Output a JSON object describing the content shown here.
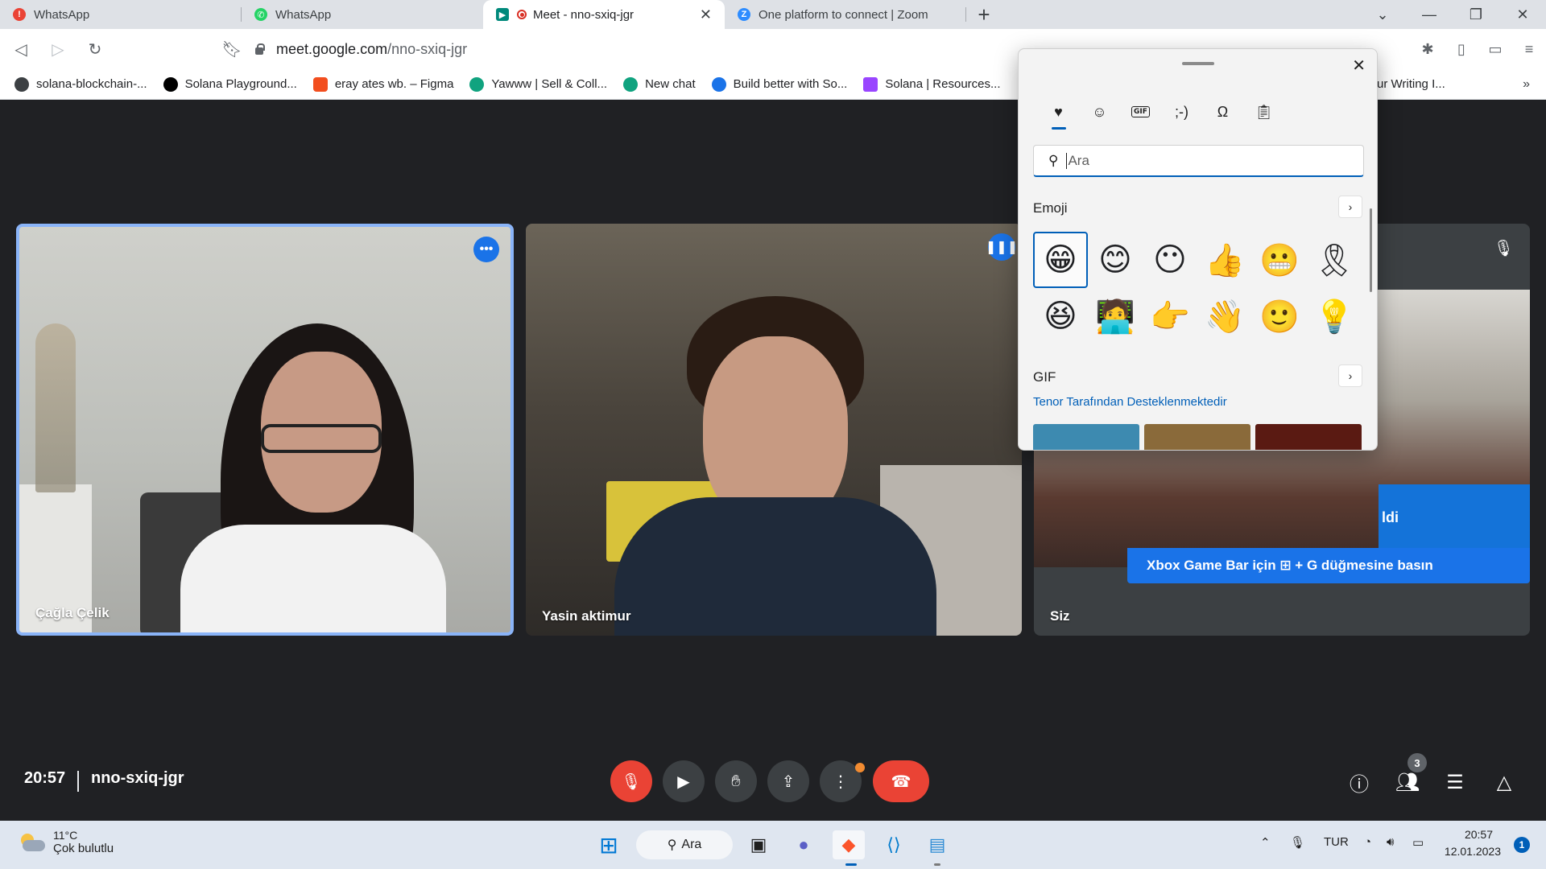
{
  "browser": {
    "tabs": [
      {
        "title": "WhatsApp",
        "icon": "alert-icon",
        "color": "#ea4335"
      },
      {
        "title": "WhatsApp",
        "icon": "whatsapp-icon",
        "color": "#25d366"
      },
      {
        "title": "Meet - nno-sxiq-jgr",
        "icon": "meet-icon",
        "color": "#00897b",
        "active": true
      },
      {
        "title": "One platform to connect | Zoom",
        "icon": "zoom-icon",
        "color": "#2d8cff"
      }
    ],
    "url_host": "meet.google.com",
    "url_path": "/nno-sxiq-jgr",
    "bookmarks": [
      {
        "label": "solana-blockchain-...",
        "color": "#3c4043"
      },
      {
        "label": "Solana Playground...",
        "color": "#000000"
      },
      {
        "label": "eray ates wb. – Figma",
        "color": "#f24e1e"
      },
      {
        "label": "Yawww | Sell & Coll...",
        "color": "#10a37f"
      },
      {
        "label": "New chat",
        "color": "#10a37f"
      },
      {
        "label": "Build better with So...",
        "color": "#1a73e8"
      },
      {
        "label": "Solana | Resources...",
        "color": "#9945ff"
      },
      {
        "label": "ur Writing I...",
        "color": "#6a1b9a"
      }
    ],
    "bookmarks_more": "»"
  },
  "meet": {
    "participants": [
      {
        "name": "Çağla Çelik"
      },
      {
        "name": "Yasin aktimur"
      },
      {
        "name": "Siz"
      }
    ],
    "time": "20:57",
    "code": "nno-sxiq-jgr",
    "people_count": "3",
    "xbox_toast": "Xbox Game Bar için ⊞ + G düğmesine basın",
    "xbox_top_fragment": "ldi"
  },
  "emoji_panel": {
    "search_placeholder": "Ara",
    "emoji_section": "Emoji",
    "gif_section": "GIF",
    "tenor_text": "Tenor Tarafından Desteklenmektedir",
    "tabs": [
      "recent-heart-icon",
      "smiley-icon",
      "gif-icon",
      "kaomoji-icon",
      "symbols-icon",
      "clipboard-icon"
    ],
    "kaomoji_label": ";-)",
    "gif_label": "GIF",
    "emojis": [
      "😁",
      "😊",
      "😶",
      "👍",
      "😬",
      "🎗",
      "😆",
      "🧑‍💻",
      "👉",
      "👋",
      "🙂",
      "💡"
    ]
  },
  "taskbar": {
    "weather_temp": "11°C",
    "weather_desc": "Çok bulutlu",
    "search_label": "Ara",
    "language": "TUR",
    "clock_time": "20:57",
    "clock_date": "12.01.2023",
    "notification_count": "1"
  }
}
